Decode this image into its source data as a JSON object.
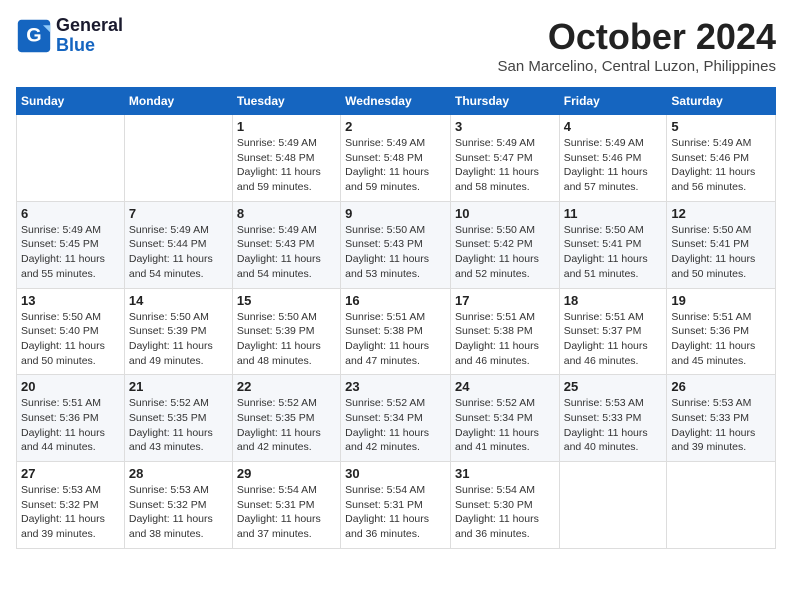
{
  "logo": {
    "line1": "General",
    "line2": "Blue"
  },
  "title": "October 2024",
  "location": "San Marcelino, Central Luzon, Philippines",
  "weekdays": [
    "Sunday",
    "Monday",
    "Tuesday",
    "Wednesday",
    "Thursday",
    "Friday",
    "Saturday"
  ],
  "weeks": [
    [
      null,
      null,
      {
        "day": 1,
        "sunrise": "5:49 AM",
        "sunset": "5:48 PM",
        "daylight": "11 hours and 59 minutes."
      },
      {
        "day": 2,
        "sunrise": "5:49 AM",
        "sunset": "5:48 PM",
        "daylight": "11 hours and 59 minutes."
      },
      {
        "day": 3,
        "sunrise": "5:49 AM",
        "sunset": "5:47 PM",
        "daylight": "11 hours and 58 minutes."
      },
      {
        "day": 4,
        "sunrise": "5:49 AM",
        "sunset": "5:46 PM",
        "daylight": "11 hours and 57 minutes."
      },
      {
        "day": 5,
        "sunrise": "5:49 AM",
        "sunset": "5:46 PM",
        "daylight": "11 hours and 56 minutes."
      }
    ],
    [
      {
        "day": 6,
        "sunrise": "5:49 AM",
        "sunset": "5:45 PM",
        "daylight": "11 hours and 55 minutes."
      },
      {
        "day": 7,
        "sunrise": "5:49 AM",
        "sunset": "5:44 PM",
        "daylight": "11 hours and 54 minutes."
      },
      {
        "day": 8,
        "sunrise": "5:49 AM",
        "sunset": "5:43 PM",
        "daylight": "11 hours and 54 minutes."
      },
      {
        "day": 9,
        "sunrise": "5:50 AM",
        "sunset": "5:43 PM",
        "daylight": "11 hours and 53 minutes."
      },
      {
        "day": 10,
        "sunrise": "5:50 AM",
        "sunset": "5:42 PM",
        "daylight": "11 hours and 52 minutes."
      },
      {
        "day": 11,
        "sunrise": "5:50 AM",
        "sunset": "5:41 PM",
        "daylight": "11 hours and 51 minutes."
      },
      {
        "day": 12,
        "sunrise": "5:50 AM",
        "sunset": "5:41 PM",
        "daylight": "11 hours and 50 minutes."
      }
    ],
    [
      {
        "day": 13,
        "sunrise": "5:50 AM",
        "sunset": "5:40 PM",
        "daylight": "11 hours and 50 minutes."
      },
      {
        "day": 14,
        "sunrise": "5:50 AM",
        "sunset": "5:39 PM",
        "daylight": "11 hours and 49 minutes."
      },
      {
        "day": 15,
        "sunrise": "5:50 AM",
        "sunset": "5:39 PM",
        "daylight": "11 hours and 48 minutes."
      },
      {
        "day": 16,
        "sunrise": "5:51 AM",
        "sunset": "5:38 PM",
        "daylight": "11 hours and 47 minutes."
      },
      {
        "day": 17,
        "sunrise": "5:51 AM",
        "sunset": "5:38 PM",
        "daylight": "11 hours and 46 minutes."
      },
      {
        "day": 18,
        "sunrise": "5:51 AM",
        "sunset": "5:37 PM",
        "daylight": "11 hours and 46 minutes."
      },
      {
        "day": 19,
        "sunrise": "5:51 AM",
        "sunset": "5:36 PM",
        "daylight": "11 hours and 45 minutes."
      }
    ],
    [
      {
        "day": 20,
        "sunrise": "5:51 AM",
        "sunset": "5:36 PM",
        "daylight": "11 hours and 44 minutes."
      },
      {
        "day": 21,
        "sunrise": "5:52 AM",
        "sunset": "5:35 PM",
        "daylight": "11 hours and 43 minutes."
      },
      {
        "day": 22,
        "sunrise": "5:52 AM",
        "sunset": "5:35 PM",
        "daylight": "11 hours and 42 minutes."
      },
      {
        "day": 23,
        "sunrise": "5:52 AM",
        "sunset": "5:34 PM",
        "daylight": "11 hours and 42 minutes."
      },
      {
        "day": 24,
        "sunrise": "5:52 AM",
        "sunset": "5:34 PM",
        "daylight": "11 hours and 41 minutes."
      },
      {
        "day": 25,
        "sunrise": "5:53 AM",
        "sunset": "5:33 PM",
        "daylight": "11 hours and 40 minutes."
      },
      {
        "day": 26,
        "sunrise": "5:53 AM",
        "sunset": "5:33 PM",
        "daylight": "11 hours and 39 minutes."
      }
    ],
    [
      {
        "day": 27,
        "sunrise": "5:53 AM",
        "sunset": "5:32 PM",
        "daylight": "11 hours and 39 minutes."
      },
      {
        "day": 28,
        "sunrise": "5:53 AM",
        "sunset": "5:32 PM",
        "daylight": "11 hours and 38 minutes."
      },
      {
        "day": 29,
        "sunrise": "5:54 AM",
        "sunset": "5:31 PM",
        "daylight": "11 hours and 37 minutes."
      },
      {
        "day": 30,
        "sunrise": "5:54 AM",
        "sunset": "5:31 PM",
        "daylight": "11 hours and 36 minutes."
      },
      {
        "day": 31,
        "sunrise": "5:54 AM",
        "sunset": "5:30 PM",
        "daylight": "11 hours and 36 minutes."
      },
      null,
      null
    ]
  ],
  "labels": {
    "sunrise": "Sunrise:",
    "sunset": "Sunset:",
    "daylight": "Daylight:"
  }
}
